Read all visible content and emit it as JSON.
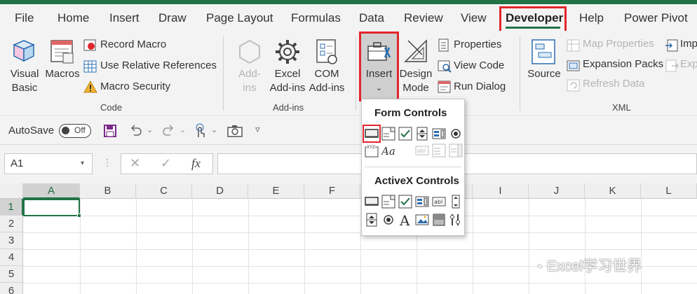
{
  "tabs": [
    "File",
    "Home",
    "Insert",
    "Draw",
    "Page Layout",
    "Formulas",
    "Data",
    "Review",
    "View",
    "Developer",
    "Help",
    "Power Pivot"
  ],
  "active_tab": "Developer",
  "ribbon": {
    "code": {
      "visual_basic": [
        "Visual",
        "Basic"
      ],
      "macros": "Macros",
      "record_macro": "Record Macro",
      "relative_refs": "Use Relative References",
      "macro_security": "Macro Security",
      "group_label": "Code"
    },
    "addins": {
      "addins": [
        "Add-",
        "ins"
      ],
      "excel_addins": [
        "Excel",
        "Add-ins"
      ],
      "com_addins": [
        "COM",
        "Add-ins"
      ],
      "group_label": "Add-ins"
    },
    "controls": {
      "insert": "Insert",
      "design_mode": [
        "Design",
        "Mode"
      ],
      "properties": "Properties",
      "view_code": "View Code",
      "run_dialog": "Run Dialog"
    },
    "xml": {
      "source": "Source",
      "map_properties": "Map Properties",
      "expansion_packs": "Expansion Packs",
      "refresh_data": "Refresh Data",
      "import": "Imp",
      "export": "Exp",
      "group_label": "XML"
    }
  },
  "qat": {
    "autosave": "AutoSave",
    "toggle": "Off"
  },
  "formula_bar": {
    "name_box": "A1",
    "fx": "fx",
    "formula": ""
  },
  "grid": {
    "columns": [
      "A",
      "B",
      "C",
      "D",
      "E",
      "F",
      "G",
      "H",
      "I",
      "J",
      "K",
      "L"
    ],
    "rows": [
      "1",
      "2",
      "3",
      "4",
      "5",
      "6"
    ],
    "selected_cell": "A1"
  },
  "insert_dropdown": {
    "form_controls": "Form Controls",
    "activex_controls": "ActiveX Controls",
    "form_icons": [
      "button-control-icon",
      "combo-box-control-icon",
      "check-box-control-icon",
      "spin-button-control-icon",
      "list-box-control-icon",
      "option-button-control-icon",
      "group-box-control-icon",
      "label-control-icon",
      "text-field-control-icon",
      "combo-list-edit-icon",
      "combo-dropdown-edit-icon"
    ],
    "activex_icons": [
      "command-button-icon",
      "combo-box-icon",
      "check-box-icon",
      "list-box-icon",
      "text-box-icon",
      "scroll-bar-icon",
      "spin-button-icon",
      "option-button-icon",
      "label-icon",
      "image-icon",
      "toggle-button-icon",
      "more-controls-icon"
    ]
  },
  "watermark": "Excel学习世界",
  "colors": {
    "excel_green": "#217346",
    "highlight_red": "#e2262d"
  }
}
